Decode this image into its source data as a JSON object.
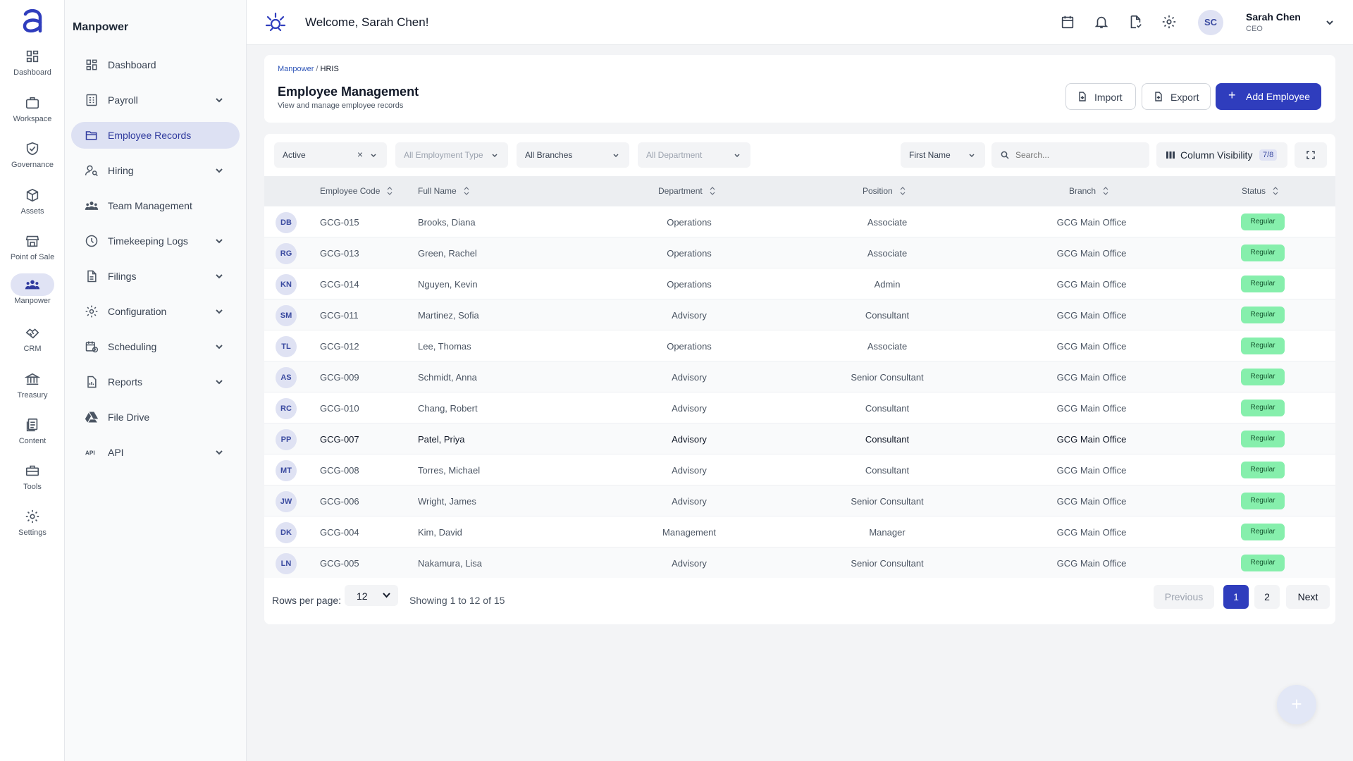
{
  "rail": [
    {
      "label": "Dashboard",
      "icon": "grid-icon"
    },
    {
      "label": "Workspace",
      "icon": "briefcase-icon"
    },
    {
      "label": "Governance",
      "icon": "shield-check-icon"
    },
    {
      "label": "Assets",
      "icon": "cube-icon"
    },
    {
      "label": "Point of Sale",
      "icon": "store-icon"
    },
    {
      "label": "Manpower",
      "icon": "people-icon"
    },
    {
      "label": "CRM",
      "icon": "handshake-icon"
    },
    {
      "label": "Treasury",
      "icon": "bank-icon"
    },
    {
      "label": "Content",
      "icon": "documents-icon"
    },
    {
      "label": "Tools",
      "icon": "toolbox-icon"
    },
    {
      "label": "Settings",
      "icon": "gear-icon"
    }
  ],
  "sidebar": {
    "title": "Manpower",
    "items": [
      {
        "label": "Dashboard",
        "icon": "dashboard-icon"
      },
      {
        "label": "Payroll",
        "icon": "payroll-icon"
      },
      {
        "label": "Employee Records",
        "icon": "folder-open-icon"
      },
      {
        "label": "Hiring",
        "icon": "person-search-icon"
      },
      {
        "label": "Team Management",
        "icon": "team-icon"
      },
      {
        "label": "Timekeeping Logs",
        "icon": "clock-icon"
      },
      {
        "label": "Filings",
        "icon": "file-icon"
      },
      {
        "label": "Configuration",
        "icon": "gear-icon"
      },
      {
        "label": "Scheduling",
        "icon": "calendar-clock-icon"
      },
      {
        "label": "Reports",
        "icon": "report-icon"
      },
      {
        "label": "File Drive",
        "icon": "drive-icon"
      },
      {
        "label": "API",
        "icon": "api-icon"
      }
    ]
  },
  "header": {
    "welcome": "Welcome, Sarah Chen!",
    "user_initials": "SC",
    "user_name": "Sarah Chen",
    "user_role": "CEO"
  },
  "page": {
    "breadcrumb_root": "Manpower",
    "breadcrumb_sep": "/",
    "breadcrumb_current": "HRIS",
    "title": "Employee Management",
    "subtitle": "View and manage employee records",
    "import_label": "Import",
    "export_label": "Export",
    "add_label": "Add Employee"
  },
  "filters": {
    "status": "Active",
    "employment_type": "All Employment Type",
    "branches": "All Branches",
    "department": "All Department",
    "sort_field": "First Name",
    "search_placeholder": "Search...",
    "column_visibility": "Column Visibility",
    "column_count": "7/8"
  },
  "table": {
    "columns": [
      "Employee Code",
      "Full Name",
      "Department",
      "Position",
      "Branch",
      "Status"
    ],
    "rows": [
      {
        "initials": "DB",
        "code": "GCG-015",
        "name": "Brooks, Diana",
        "department": "Operations",
        "position": "Associate",
        "branch": "GCG Main Office",
        "status": "Regular"
      },
      {
        "initials": "RG",
        "code": "GCG-013",
        "name": "Green, Rachel",
        "department": "Operations",
        "position": "Associate",
        "branch": "GCG Main Office",
        "status": "Regular"
      },
      {
        "initials": "KN",
        "code": "GCG-014",
        "name": "Nguyen, Kevin",
        "department": "Operations",
        "position": "Admin",
        "branch": "GCG Main Office",
        "status": "Regular"
      },
      {
        "initials": "SM",
        "code": "GCG-011",
        "name": "Martinez, Sofia",
        "department": "Advisory",
        "position": "Consultant",
        "branch": "GCG Main Office",
        "status": "Regular"
      },
      {
        "initials": "TL",
        "code": "GCG-012",
        "name": "Lee, Thomas",
        "department": "Operations",
        "position": "Associate",
        "branch": "GCG Main Office",
        "status": "Regular"
      },
      {
        "initials": "AS",
        "code": "GCG-009",
        "name": "Schmidt, Anna",
        "department": "Advisory",
        "position": "Senior Consultant",
        "branch": "GCG Main Office",
        "status": "Regular"
      },
      {
        "initials": "RC",
        "code": "GCG-010",
        "name": "Chang, Robert",
        "department": "Advisory",
        "position": "Consultant",
        "branch": "GCG Main Office",
        "status": "Regular"
      },
      {
        "initials": "PP",
        "code": "GCG-007",
        "name": "Patel, Priya",
        "department": "Advisory",
        "position": "Consultant",
        "branch": "GCG Main Office",
        "status": "Regular"
      },
      {
        "initials": "MT",
        "code": "GCG-008",
        "name": "Torres, Michael",
        "department": "Advisory",
        "position": "Consultant",
        "branch": "GCG Main Office",
        "status": "Regular"
      },
      {
        "initials": "JW",
        "code": "GCG-006",
        "name": "Wright, James",
        "department": "Advisory",
        "position": "Senior Consultant",
        "branch": "GCG Main Office",
        "status": "Regular"
      },
      {
        "initials": "DK",
        "code": "GCG-004",
        "name": "Kim, David",
        "department": "Management",
        "position": "Manager",
        "branch": "GCG Main Office",
        "status": "Regular"
      },
      {
        "initials": "LN",
        "code": "GCG-005",
        "name": "Nakamura, Lisa",
        "department": "Advisory",
        "position": "Senior Consultant",
        "branch": "GCG Main Office",
        "status": "Regular"
      }
    ]
  },
  "pagination": {
    "rows_per_page_label": "Rows per page:",
    "rows_per_page": "12",
    "showing": "Showing 1 to 12 of 15",
    "previous": "Previous",
    "page1": "1",
    "page2": "2",
    "next": "Next"
  },
  "fab": {
    "label": "+"
  },
  "colors": {
    "primary": "#2f3dbd",
    "active_nav": "#dde1f3",
    "badge": "#86efac"
  }
}
